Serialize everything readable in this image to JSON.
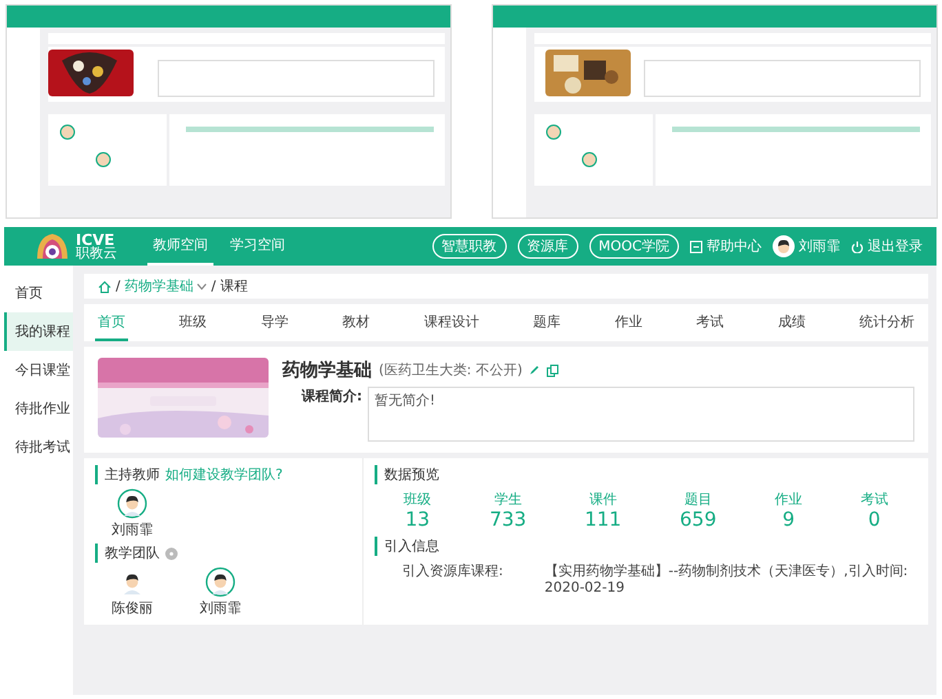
{
  "header": {
    "logo": "ICVE",
    "logo_sub": "职教云",
    "nav": [
      {
        "label": "教师空间",
        "selected": true
      },
      {
        "label": "学习空间",
        "selected": false
      }
    ],
    "links": [
      "智慧职教",
      "资源库",
      "MOOC学院"
    ],
    "help": "帮助中心",
    "user": "刘雨霏",
    "logout": "退出登录"
  },
  "sidebar": {
    "items": [
      {
        "label": "首页",
        "selected": false
      },
      {
        "label": "我的课程",
        "selected": true
      },
      {
        "label": "今日课堂",
        "selected": false
      },
      {
        "label": "待批作业",
        "selected": false
      },
      {
        "label": "待批考试",
        "selected": false
      }
    ]
  },
  "breadcrumb": [
    {
      "kind": "separator",
      "text": "/"
    },
    {
      "kind": "link",
      "text": "药物学基础"
    },
    {
      "kind": "separator",
      "text": "/"
    },
    {
      "kind": "current",
      "text": "课程"
    }
  ],
  "tabs": [
    {
      "label": "首页",
      "selected": true
    },
    {
      "label": "班级",
      "selected": false
    },
    {
      "label": "导学",
      "selected": false
    },
    {
      "label": "教材",
      "selected": false
    },
    {
      "label": "课程设计",
      "selected": false
    },
    {
      "label": "题库",
      "selected": false
    },
    {
      "label": "作业",
      "selected": false
    },
    {
      "label": "考试",
      "selected": false
    },
    {
      "label": "成绩",
      "selected": false
    },
    {
      "label": "统计分析",
      "selected": false
    }
  ],
  "course": {
    "title": "药物学基础",
    "meta": "(医药卫生大类: 不公开)",
    "intro_label": "课程简介:",
    "intro": "暂无简介!"
  },
  "host": {
    "title": "主持教师",
    "link": "如何建设教学团队?",
    "teachers": [
      {
        "name": "刘雨霏",
        "ringed": true
      }
    ]
  },
  "team": {
    "title": "教学团队",
    "members": [
      {
        "name": "陈俊丽",
        "ringed": false
      },
      {
        "name": "刘雨霏",
        "ringed": true
      }
    ]
  },
  "stats": {
    "title": "数据预览",
    "items": [
      {
        "label": "班级",
        "value": "13"
      },
      {
        "label": "学生",
        "value": "733"
      },
      {
        "label": "课件",
        "value": "111"
      },
      {
        "label": "题目",
        "value": "659"
      },
      {
        "label": "作业",
        "value": "9"
      },
      {
        "label": "考试",
        "value": "0"
      }
    ]
  },
  "import": {
    "title": "引入信息",
    "label": "引入资源库课程:",
    "text": "【实用药物学基础】--药物制剂技术（天津医专）,引入时间: 2020-02-19"
  }
}
